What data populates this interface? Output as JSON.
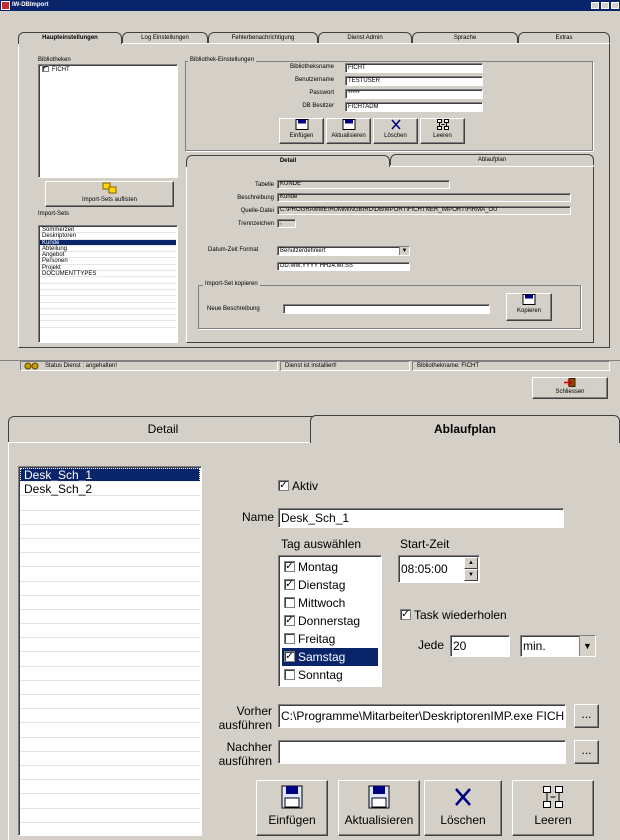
{
  "window": {
    "title": "IW-DBImport"
  },
  "tabs": [
    "Haupteinstellungen",
    "Log Einstellungen",
    "Fehlerbenachrichtigung",
    "Dienst Admin",
    "Sprache",
    "Extras"
  ],
  "bibliotheken": {
    "legend": "Bibliotheken",
    "items": [
      "FICHT"
    ]
  },
  "bib_settings": {
    "legend": "Bibliothek-Einstellungen",
    "name_label": "Bibliotheksname",
    "name_value": "FICHT",
    "user_label": "Benutzername",
    "user_value": "TESTUSER",
    "pw_label": "Passwort",
    "pw_value": "*****",
    "owner_label": "DB Besitzer",
    "owner_value": "FICHTADM"
  },
  "buttons": {
    "insert": "Einfügen",
    "update": "Aktualisieren",
    "delete": "Löschen",
    "clear": "Leeren",
    "list_sets": "Import-Sets auflisten",
    "copy": "Kopieren",
    "close": "Schliessen"
  },
  "import_sets": {
    "label": "Import-Sets",
    "items": [
      "Sommerzeit",
      "Deskriptoren",
      "Kunde",
      "Abteilung",
      "Angebot",
      "Personen",
      "Projekt",
      "DOCUMENTTYPES"
    ],
    "selected": 2
  },
  "subtabs": [
    "Detail",
    "Ablaufplan"
  ],
  "detail": {
    "table_label": "Tabelle",
    "table_value": "KUNDE",
    "desc_label": "Beschreibung",
    "desc_value": "Kunde",
    "source_label": "Quelle-Datei",
    "source_value": "C:\\PROGRAMME\\HUMMINGBIRD\\DBIMPORT\\FICHTNER_IMPORT\\FIRMA_OU",
    "sep_label": "Trennzeichen",
    "sep_value": ";",
    "dt_label": "Datum-Zeit Format",
    "dt_value": "Benutzerdefiniert",
    "dt_pattern": "DD.MM.YYYY HH24:MI:SS",
    "copy_legend": "Import-Set kopieren",
    "newdesc_label": "Neue Beschreibung",
    "newdesc_value": ""
  },
  "status": {
    "service": "Status Dienst : angehalten!",
    "installed": "Dienst ist installiert!",
    "libname": "Bibliothekname: FICHT"
  },
  "schedule": {
    "list": [
      "Desk_Sch_1",
      "Desk_Sch_2"
    ],
    "active_label": "Aktiv",
    "name_label": "Name",
    "name_value": "Desk_Sch_1",
    "day_label": "Tag auswählen",
    "days": [
      {
        "label": "Montag",
        "checked": true
      },
      {
        "label": "Dienstag",
        "checked": true
      },
      {
        "label": "Mittwoch",
        "checked": false
      },
      {
        "label": "Donnerstag",
        "checked": true
      },
      {
        "label": "Freitag",
        "checked": false
      },
      {
        "label": "Samstag",
        "checked": true
      },
      {
        "label": "Sonntag",
        "checked": false
      }
    ],
    "selected_day": 5,
    "start_label": "Start-Zeit",
    "start_value": "08:05:00",
    "repeat_label": "Task wiederholen",
    "every_label": "Jede",
    "every_value": "20",
    "unit_value": "min.",
    "before_label_1": "Vorher",
    "before_label_2": "ausführen",
    "before_value": "C:\\Programme\\Mitarbeiter\\DeskriptorenIMP.exe FICH",
    "after_label_1": "Nachher",
    "after_label_2": "ausführen",
    "after_value": "",
    "browse": "..."
  }
}
